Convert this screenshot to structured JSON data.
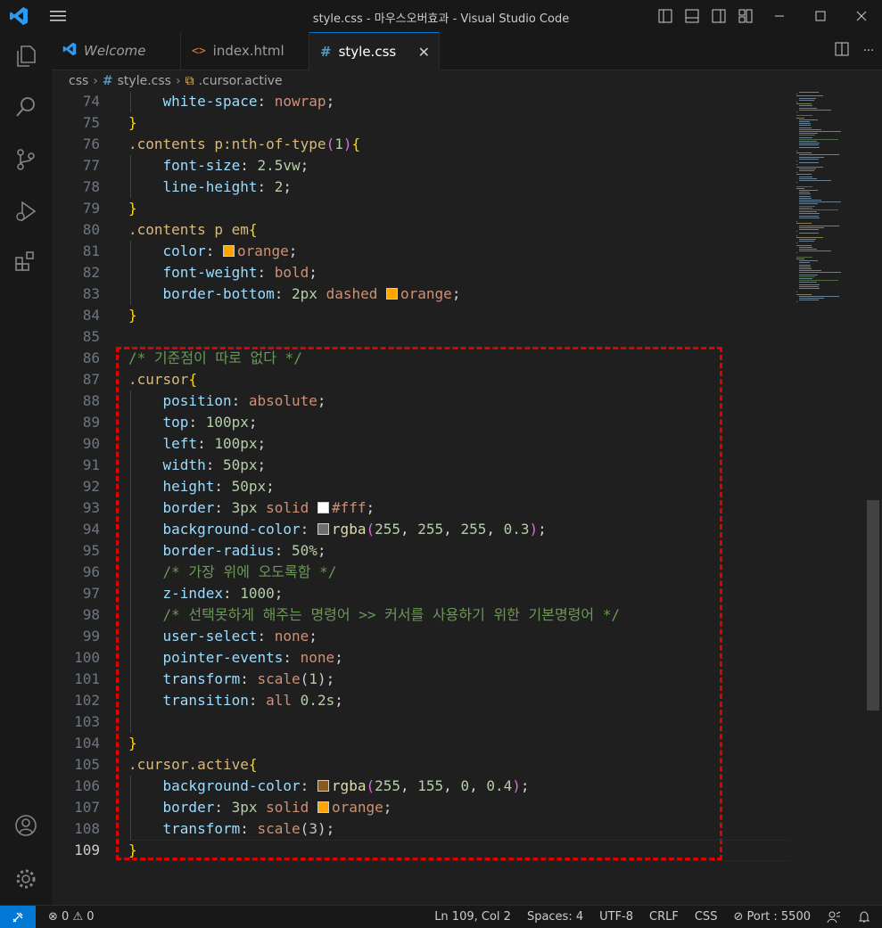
{
  "window": {
    "title": "style.css - 마우스오버효과 - Visual Studio Code",
    "brand_color": "#0078d4"
  },
  "tabs": [
    {
      "label": "Welcome",
      "icon": "vscode-logo-icon"
    },
    {
      "label": "index.html",
      "icon": "html-brackets-icon"
    },
    {
      "label": "style.css",
      "icon": "css-hash-icon",
      "close": "✕",
      "active": true
    }
  ],
  "breadcrumb": {
    "folder": "css",
    "file_icon": "#",
    "file": "style.css",
    "symbol": ".cursor.active"
  },
  "editor": {
    "current_line": "109",
    "lines": [
      {
        "n": "74",
        "t": "    white-space: nowrap;"
      },
      {
        "n": "75",
        "t": "}"
      },
      {
        "n": "76",
        "t": ".contents p:nth-of-type(1){"
      },
      {
        "n": "77",
        "t": "    font-size: 2.5vw;"
      },
      {
        "n": "78",
        "t": "    line-height: 2;"
      },
      {
        "n": "79",
        "t": "}"
      },
      {
        "n": "80",
        "t": ".contents p em{"
      },
      {
        "n": "81",
        "t": "    color: orange;"
      },
      {
        "n": "82",
        "t": "    font-weight: bold;"
      },
      {
        "n": "83",
        "t": "    border-bottom: 2px dashed orange;"
      },
      {
        "n": "84",
        "t": "}"
      },
      {
        "n": "85",
        "t": ""
      },
      {
        "n": "86",
        "t": "/* 기준점이 따로 없다 */"
      },
      {
        "n": "87",
        "t": ".cursor{"
      },
      {
        "n": "88",
        "t": "    position: absolute;"
      },
      {
        "n": "89",
        "t": "    top: 100px;"
      },
      {
        "n": "90",
        "t": "    left: 100px;"
      },
      {
        "n": "91",
        "t": "    width: 50px;"
      },
      {
        "n": "92",
        "t": "    height: 50px;"
      },
      {
        "n": "93",
        "t": "    border: 3px solid #fff;"
      },
      {
        "n": "94",
        "t": "    background-color: rgba(255, 255, 255, 0.3);"
      },
      {
        "n": "95",
        "t": "    border-radius: 50%;"
      },
      {
        "n": "96",
        "t": "    /* 가장 위에 오도록함 */"
      },
      {
        "n": "97",
        "t": "    z-index: 1000;"
      },
      {
        "n": "98",
        "t": "    /* 선택못하게 해주는 명령어 >> 커서를 사용하기 위한 기본명령어 */"
      },
      {
        "n": "99",
        "t": "    user-select: none;"
      },
      {
        "n": "100",
        "t": "    pointer-events: none;"
      },
      {
        "n": "101",
        "t": "    transform: scale(1);"
      },
      {
        "n": "102",
        "t": "    transition: all 0.2s;"
      },
      {
        "n": "103",
        "t": ""
      },
      {
        "n": "104",
        "t": "}"
      },
      {
        "n": "105",
        "t": ".cursor.active{"
      },
      {
        "n": "106",
        "t": "    background-color: rgba(255, 155, 0, 0.4);"
      },
      {
        "n": "107",
        "t": "    border: 3px solid orange;"
      },
      {
        "n": "108",
        "t": "    transform: scale(3);"
      },
      {
        "n": "109",
        "t": "}"
      }
    ],
    "swatches": {
      "orange": "#ffa500",
      "white": "#ffffff",
      "white_alpha": "#6e6e6e",
      "orange_alpha": "#8a5a1a"
    },
    "highlight_box_color": "#e00000"
  },
  "statusbar": {
    "errors": "0",
    "warnings": "0",
    "position": "Ln 109, Col 2",
    "spaces": "Spaces: 4",
    "encoding": "UTF-8",
    "eol": "CRLF",
    "language": "CSS",
    "port": "Port : 5500"
  }
}
